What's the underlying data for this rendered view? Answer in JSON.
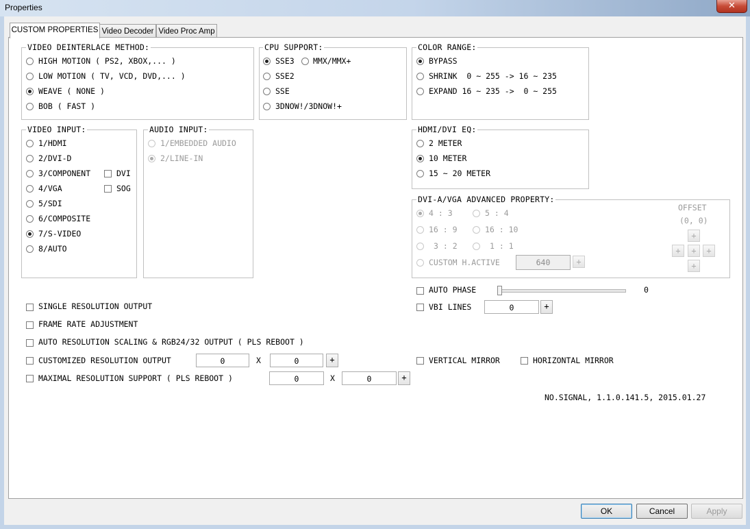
{
  "window": {
    "title": "Properties",
    "close_glyph": "✕"
  },
  "tabs": [
    "CUSTOM PROPERTIES",
    "Video Decoder",
    "Video Proc Amp"
  ],
  "deinterlace": {
    "title": "VIDEO DEINTERLACE METHOD:",
    "options": [
      "HIGH MOTION ( PS2, XBOX,... )",
      "LOW MOTION ( TV, VCD, DVD,... )",
      "WEAVE ( NONE )",
      "BOB ( FAST )"
    ],
    "selected": 2
  },
  "cpu": {
    "title": "CPU SUPPORT:",
    "options": [
      "SSE3",
      "MMX/MMX+",
      "SSE2",
      "SSE",
      "3DNOW!/3DNOW!+"
    ],
    "selected": 0
  },
  "color_range": {
    "title": "COLOR RANGE:",
    "options": [
      "BYPASS",
      "SHRINK  0 ~ 255 -> 16 ~ 235",
      "EXPAND 16 ~ 235 ->  0 ~ 255"
    ],
    "selected": 0
  },
  "video_input": {
    "title": "VIDEO INPUT:",
    "options": [
      "1/HDMI",
      "2/DVI-D",
      "3/COMPONENT",
      "4/VGA",
      "5/SDI",
      "6/COMPOSITE",
      "7/S-VIDEO",
      "8/AUTO"
    ],
    "selected": 6,
    "dvi_label": "DVI",
    "sog_label": "SOG"
  },
  "audio_input": {
    "title": "AUDIO INPUT:",
    "options": [
      "1/EMBEDDED AUDIO",
      "2/LINE-IN"
    ],
    "selected": 1
  },
  "hdmi_eq": {
    "title": "HDMI/DVI EQ:",
    "options": [
      "2 METER",
      "10 METER",
      "15 ~ 20 METER"
    ],
    "selected": 1
  },
  "advanced": {
    "title": "DVI-A/VGA ADVANCED PROPERTY:",
    "ratios": [
      "4 : 3",
      "5 : 4",
      "16 : 9",
      "16 : 10",
      "3 : 2",
      "1 : 1"
    ],
    "selected": 0,
    "custom_label": "CUSTOM H.ACTIVE",
    "custom_value": "640",
    "offset_label": "OFFSET",
    "offset_value": "(0, 0)",
    "plus": "+"
  },
  "auto_phase": {
    "label": "AUTO PHASE",
    "value": "0",
    "slider_fraction": 0.0
  },
  "vbi": {
    "label": "VBI LINES",
    "value": "0"
  },
  "options": {
    "single_res": "SINGLE RESOLUTION OUTPUT",
    "frame_rate": "FRAME RATE ADJUSTMENT",
    "auto_res": "AUTO RESOLUTION SCALING & RGB24/32 OUTPUT ( PLS REBOOT )",
    "custom_res": "CUSTOMIZED RESOLUTION OUTPUT",
    "custom_w": "0",
    "custom_h": "0",
    "max_res": "MAXIMAL RESOLUTION SUPPORT ( PLS REBOOT )",
    "max_w": "0",
    "max_h": "0",
    "x": "X"
  },
  "mirror": {
    "vertical": "VERTICAL MIRROR",
    "horizontal": "HORIZONTAL MIRROR"
  },
  "status": "NO.SIGNAL, 1.1.0.141.5, 2015.01.27",
  "buttons": {
    "ok": "OK",
    "cancel": "Cancel",
    "apply": "Apply"
  }
}
